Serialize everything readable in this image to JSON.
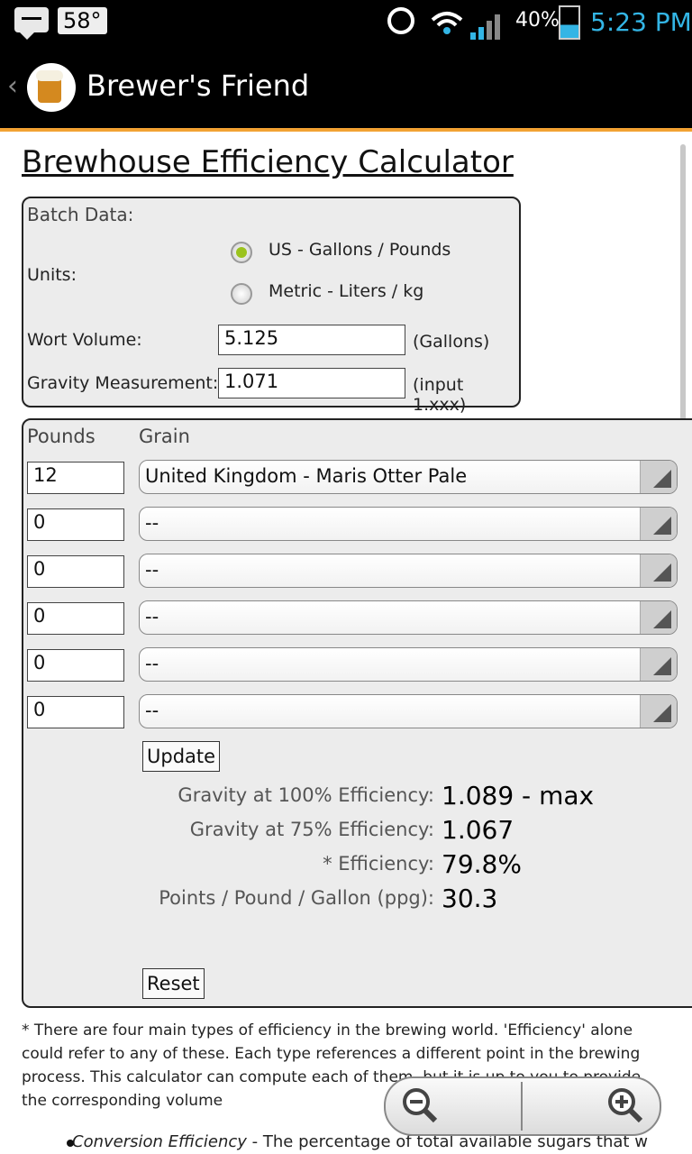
{
  "status_bar": {
    "temperature": "58°",
    "battery_percent": "40%",
    "time": "5:23 PM"
  },
  "action_bar": {
    "title": "Brewer's Friend"
  },
  "page": {
    "title": "Brewhouse Efficiency Calculator"
  },
  "batch": {
    "heading": "Batch Data:",
    "units_label": "Units:",
    "unit_options": [
      {
        "label": "US - Gallons / Pounds",
        "selected": true
      },
      {
        "label": "Metric - Liters / kg",
        "selected": false
      }
    ],
    "wort_volume_label": "Wort Volume:",
    "wort_volume_value": "5.125",
    "wort_volume_unit": "(Gallons)",
    "gravity_label": "Gravity Measurement:",
    "gravity_value": "1.071",
    "gravity_hint": "(input 1.xxx)"
  },
  "grains": {
    "pounds_header": "Pounds",
    "grain_header": "Grain",
    "rows": [
      {
        "pounds": "12",
        "grain": "United Kingdom - Maris Otter Pale"
      },
      {
        "pounds": "0",
        "grain": "--"
      },
      {
        "pounds": "0",
        "grain": "--"
      },
      {
        "pounds": "0",
        "grain": "--"
      },
      {
        "pounds": "0",
        "grain": "--"
      },
      {
        "pounds": "0",
        "grain": "--"
      }
    ],
    "update_label": "Update",
    "reset_label": "Reset"
  },
  "results": [
    {
      "label": "Gravity at 100% Efficiency:",
      "value": "1.089 - max"
    },
    {
      "label": "Gravity at 75% Efficiency:",
      "value": "1.067"
    },
    {
      "label": "* Efficiency:",
      "value": "79.8%"
    },
    {
      "label": "Points / Pound / Gallon (ppg):",
      "value": "30.3"
    }
  ],
  "note": "* There are four main types of efficiency in the brewing world. 'Efficiency' alone could refer to any of these. Each type references a different point in the brewing process. This calculator can compute each of them, but it is up to you to provide the corresponding volume",
  "bullet": {
    "term": "Conversion Efficiency",
    "text": " - The percentage of total available sugars that w"
  }
}
